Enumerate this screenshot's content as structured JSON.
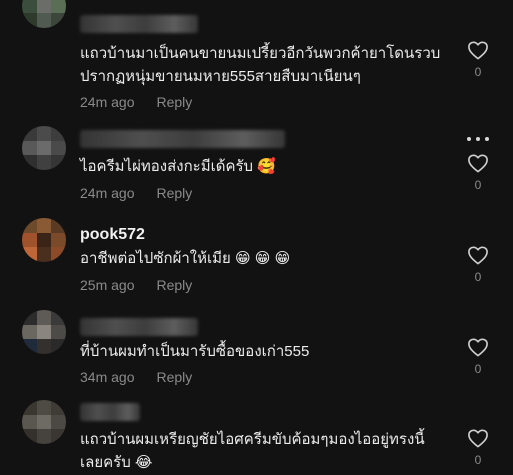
{
  "comments": [
    {
      "username": "",
      "text": "แถวบ้านมาเป็นคนขายนมเปรี้ยวอีกวันพวกค้ายาโดนรวบ\nปรากฏหนุ่มขายนมหาย555สายสืบมาเนียนๆ",
      "time": "24m ago",
      "reply": "Reply",
      "likes": "0"
    },
    {
      "username": "",
      "text": "ไอครีมไผ่ทองส่งกะมีเด้ครับ 🥰",
      "time": "24m ago",
      "reply": "Reply",
      "likes": "0"
    },
    {
      "username": "pook572",
      "text": "อาชีพต่อไปซักผ้าให้เมีย 😁 😁 😁",
      "time": "25m ago",
      "reply": "Reply",
      "likes": "0"
    },
    {
      "username": "",
      "text": "ที่บ้านผมทำเป็นมารับซื้อของเก่า555",
      "time": "34m ago",
      "reply": "Reply",
      "likes": "0"
    },
    {
      "username": "",
      "text": "แถวบ้านผมเหรียญชัยไอศครีมขับค้อมๆมองไออยู่ทรงนี้\nเลยครับ 😂",
      "time": "",
      "reply": "",
      "likes": "0"
    }
  ],
  "icons": {
    "like": "heart-outline-icon",
    "more": "more-dots-icon"
  },
  "colors": {
    "background": "#121212",
    "text": "#ececec",
    "muted": "#8a8a8a"
  }
}
